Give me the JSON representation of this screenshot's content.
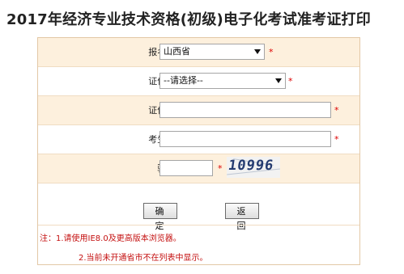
{
  "page": {
    "title": "2017年经济专业技术资格(初级)电子化考试准考证打印"
  },
  "form": {
    "city": {
      "label": "报名省市:",
      "value": "山西省",
      "required_mark": "*"
    },
    "id_type": {
      "label": "证件类型:",
      "value": "--请选择--",
      "required_mark": "*"
    },
    "id_number": {
      "label": "证件号码:",
      "value": "",
      "required_mark": "*"
    },
    "name": {
      "label": "考生姓名:",
      "value": "",
      "required_mark": "*"
    },
    "captcha": {
      "label": "验证码:",
      "value": "",
      "required_mark": "*",
      "image_text": "10996"
    }
  },
  "buttons": {
    "confirm": "确 定",
    "back": "返 回"
  },
  "notes": {
    "line1": "注：1.请使用IE8.0及更高版本浏览器。",
    "line2": "2.当前未开通省市不在列表中显示。"
  },
  "colors": {
    "border": "#e3c8a6",
    "row_shade": "#fdf0dd",
    "required": "#dd0000",
    "note": "#c41010"
  }
}
